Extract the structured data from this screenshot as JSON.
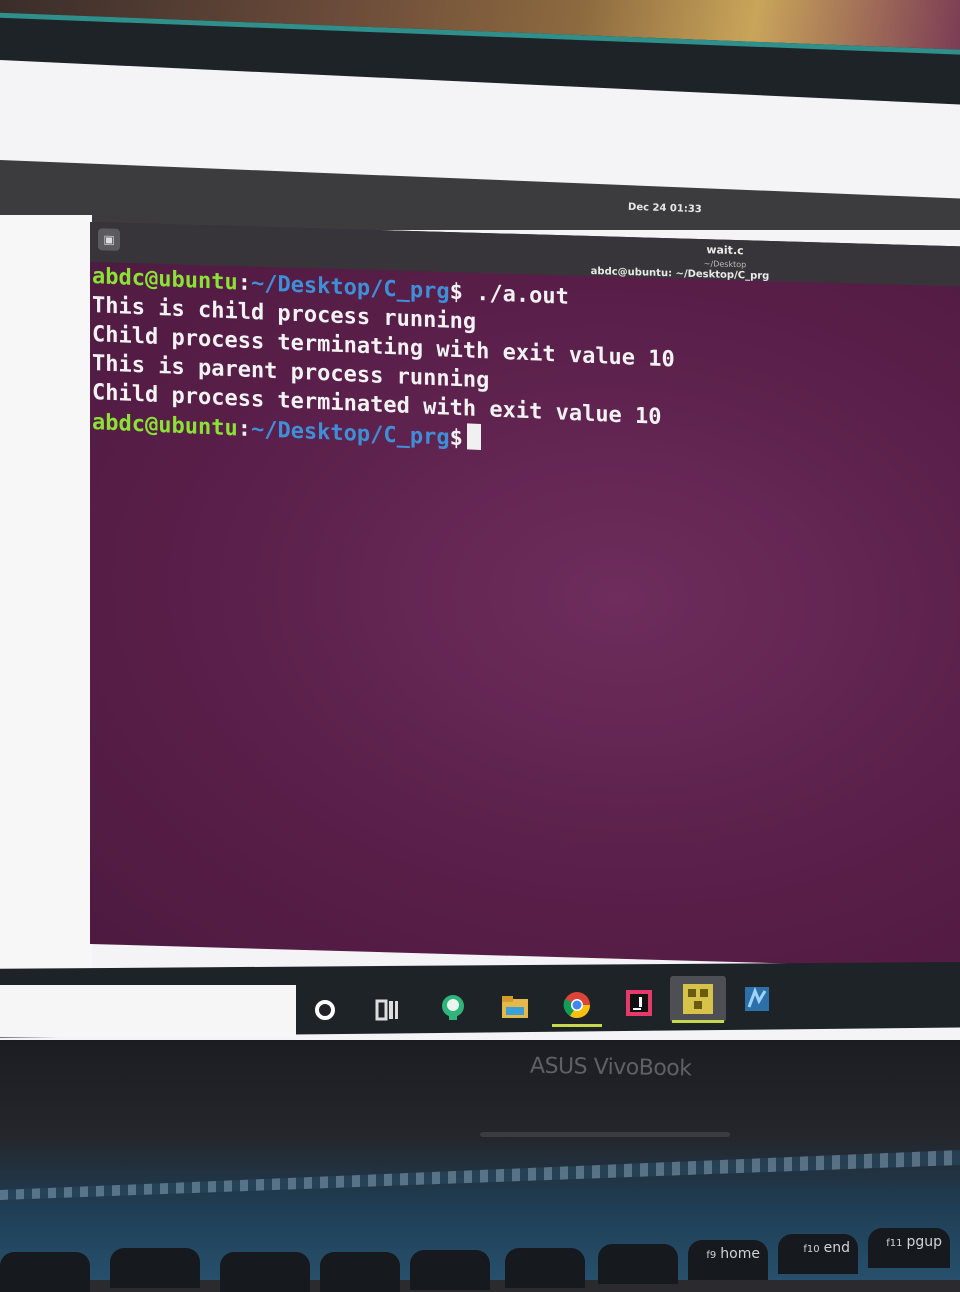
{
  "topbar": {
    "clock": "Dec 24 01:33"
  },
  "window": {
    "title": "wait.c",
    "title_sub": "~/Desktop",
    "subtitle": "abdc@ubuntu: ~/Desktop/C_prg"
  },
  "terminal": {
    "user_host": "abdc@ubuntu",
    "sep": ":",
    "path": "~/Desktop/C_prg",
    "dollar": "$",
    "command": " ./a.out",
    "output": [
      "This is child process running",
      "Child process terminating with exit value 10",
      "This is parent process running",
      "Child process terminated with exit value 10"
    ],
    "colors": {
      "bg": "#5a1f4a",
      "user": "#8ae234",
      "path": "#3f8fd8",
      "text": "#f2f2f2"
    }
  },
  "taskbar": {
    "icons": [
      "cortana-icon",
      "task-view-icon",
      "app-icon",
      "file-explorer-icon",
      "chrome-icon",
      "jetbrains-icon",
      "virtualbox-icon",
      "app-blue-icon"
    ]
  },
  "laptop": {
    "brand": "ASUS VivoBook",
    "keys": [
      "home",
      "end",
      "pgup"
    ],
    "key_fn": [
      "f9",
      "f10",
      "f11"
    ]
  }
}
